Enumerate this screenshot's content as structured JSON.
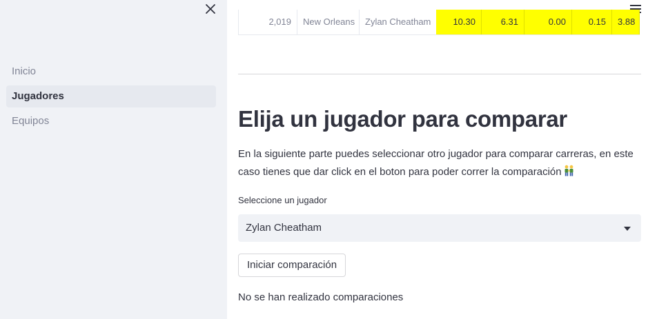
{
  "sidebar": {
    "items": [
      {
        "label": "Inicio",
        "active": false
      },
      {
        "label": "Jugadores",
        "active": true
      },
      {
        "label": "Equipos",
        "active": false
      }
    ]
  },
  "table": {
    "row": {
      "index": "2,019",
      "team": "New Orleans",
      "player": "Zylan Cheatham",
      "values": [
        "10.30",
        "6.31",
        "0.00",
        "0.15",
        "3.88"
      ]
    }
  },
  "main": {
    "heading": "Elija un jugador para comparar",
    "description": "En la siguiente parte puedes seleccionar otro jugador para comparar carreras, en este caso tienes que dar click en el boton para poder correr la comparación",
    "select_label": "Seleccione un jugador",
    "select_value": "Zylan Cheatham",
    "button_label": "Iniciar comparación",
    "status": "No se han realizado comparaciones"
  },
  "colors": {
    "highlight": "#ffff00",
    "sidebar_bg": "#f0f2f6",
    "text": "#31333f"
  },
  "icons": [
    "close-icon",
    "hamburger-menu-icon",
    "chevron-down-icon",
    "people-holding-hands-icon"
  ]
}
